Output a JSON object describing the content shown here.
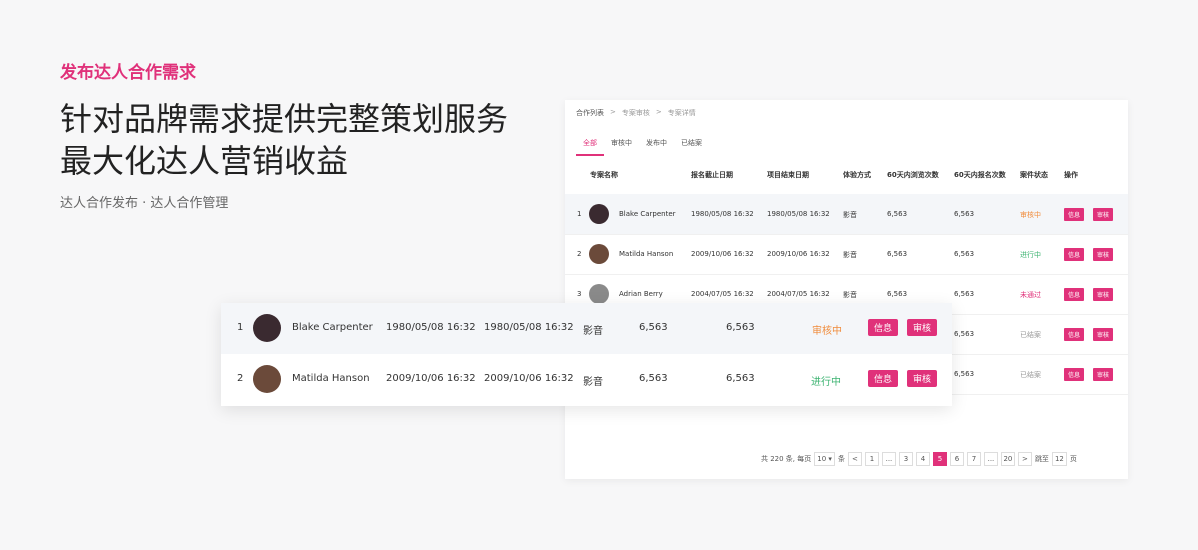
{
  "hero": {
    "kicker": "发布达人合作需求",
    "title_line1": "针对品牌需求提供完整策划服务",
    "title_line2": "最大化达人营销收益",
    "subtitle": "达人合作发布 · 达人合作管理"
  },
  "breadcrumb": [
    "合作列表",
    "专案审核",
    "专案详情"
  ],
  "breadcrumb_sep": ">",
  "tabs": [
    "全部",
    "审核中",
    "发布中",
    "已结案"
  ],
  "columns": [
    "专案名称",
    "报名截止日期",
    "项目结束日期",
    "体验方式",
    "60天内浏览次数",
    "60天内报名次数",
    "案件状态",
    "操作"
  ],
  "rows": [
    {
      "idx": "1",
      "name": "Blake Carpenter",
      "deadline": "1980/05/08 16:32",
      "end": "1980/05/08 16:32",
      "mode": "影音",
      "views": "6,563",
      "signups": "6,563",
      "status": "审核中",
      "status_color": "#f08c3c",
      "avatar": "#3a2a30"
    },
    {
      "idx": "2",
      "name": "Matilda Hanson",
      "deadline": "2009/10/06 16:32",
      "end": "2009/10/06 16:32",
      "mode": "影音",
      "views": "6,563",
      "signups": "6,563",
      "status": "进行中",
      "status_color": "#3cb371",
      "avatar": "#6b4a3a"
    },
    {
      "idx": "3",
      "name": "Adrian Berry",
      "deadline": "2004/07/05 16:32",
      "end": "2004/07/05 16:32",
      "mode": "影音",
      "views": "6,563",
      "signups": "6,563",
      "status": "未通过",
      "status_color": "#e0317a",
      "avatar": "#8a8a8a"
    },
    {
      "idx": "",
      "name": "",
      "deadline": "",
      "end": "",
      "mode": "",
      "views": "",
      "signups": "6,563",
      "status": "已结案",
      "status_color": "#999999",
      "avatar": ""
    },
    {
      "idx": "",
      "name": "",
      "deadline": "",
      "end": "",
      "mode": "",
      "views": "",
      "signups": "6,563",
      "status": "已结案",
      "status_color": "#999999",
      "avatar": ""
    }
  ],
  "actions": {
    "info": "信息",
    "review": "审核"
  },
  "pagination": {
    "total_text": "共 220 条, 每页",
    "per_page": "10",
    "per_page_unit": "条",
    "pages": [
      "1",
      "...",
      "3",
      "4",
      "5",
      "6",
      "7",
      "...",
      "20"
    ],
    "active_page": "5",
    "jump_label": "跳至",
    "jump_value": "12",
    "page_unit": "页",
    "prev": "<",
    "next": ">"
  },
  "zoom_rows": [
    {
      "idx": "1",
      "name": "Blake Carpenter",
      "deadline": "1980/05/08 16:32",
      "end": "1980/05/08 16:32",
      "mode": "影音",
      "views": "6,563",
      "signups": "6,563",
      "status": "审核中"
    },
    {
      "idx": "2",
      "name": "Matilda Hanson",
      "deadline": "2009/10/06 16:32",
      "end": "2009/10/06 16:32",
      "mode": "影音",
      "views": "6,563",
      "signups": "6,563",
      "status": "进行中"
    }
  ],
  "colors": {
    "accent": "#e0317a",
    "orange": "#f08c3c",
    "green": "#3cb371",
    "gray": "#999999"
  }
}
